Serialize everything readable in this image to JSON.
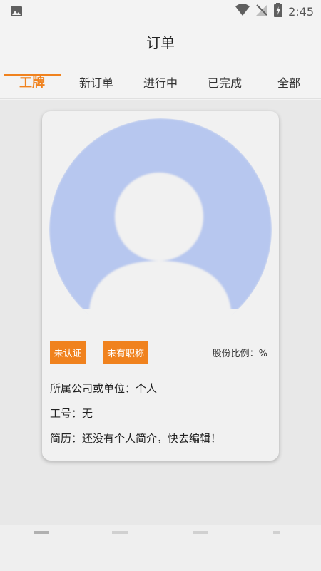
{
  "status": {
    "time": "2:45"
  },
  "header": {
    "title": "订单"
  },
  "tabs": [
    {
      "label": "工牌"
    },
    {
      "label": "新订单"
    },
    {
      "label": "进行中"
    },
    {
      "label": "已完成"
    },
    {
      "label": "全部"
    }
  ],
  "profile": {
    "badge_cert": "未认证",
    "badge_title": "未有职称",
    "share_ratio": "股份比例：%",
    "company": "所属公司或单位：个人",
    "employee_no": "工号：无",
    "bio": "简历：还没有个人简介，快去编辑！"
  },
  "colors": {
    "accent": "#f0821e",
    "avatar": "#b7c7ef"
  }
}
